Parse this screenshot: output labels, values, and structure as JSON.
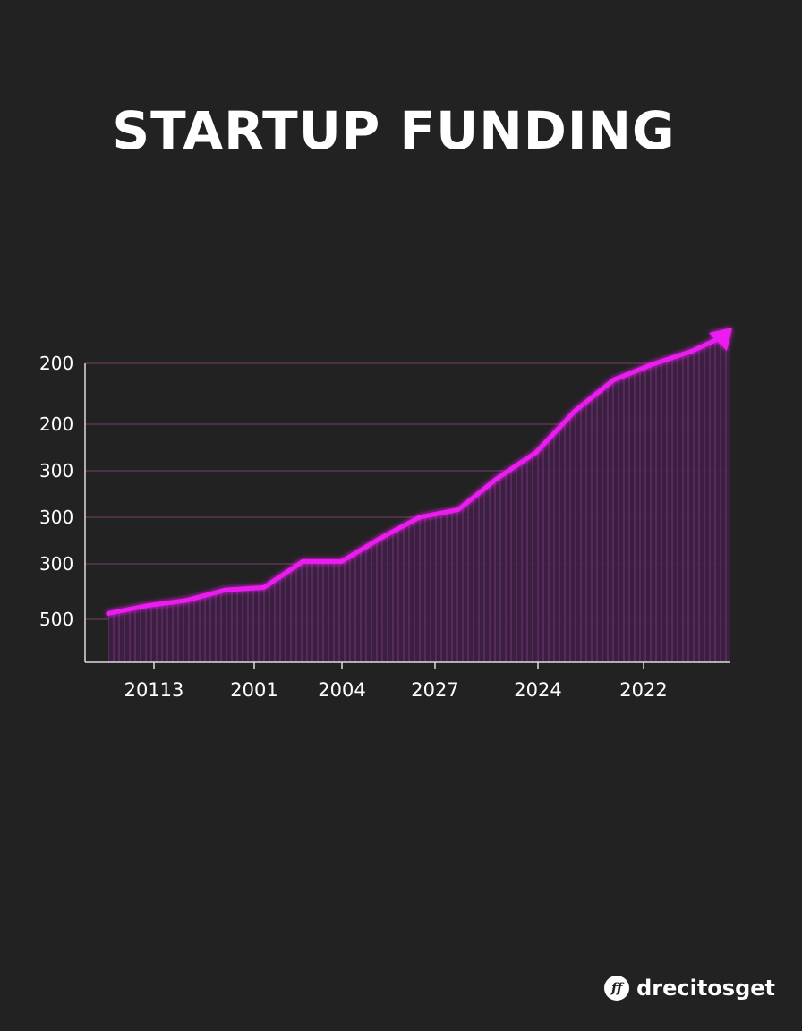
{
  "chart_data": {
    "type": "area",
    "title": "STARTUP FUNDING",
    "xlabel": "",
    "ylabel": "",
    "y_tick_labels": [
      "200",
      "200",
      "300",
      "300",
      "300",
      "500"
    ],
    "x_tick_labels": [
      "20113",
      "2001",
      "2004",
      "2027",
      "2024",
      "2022"
    ],
    "x": [
      0,
      1,
      2,
      3,
      4,
      5,
      6,
      7,
      8,
      9,
      10,
      11,
      12,
      13,
      14,
      15,
      16
    ],
    "series": [
      {
        "values": [
          0.04,
          0.07,
          0.09,
          0.13,
          0.14,
          0.24,
          0.24,
          0.33,
          0.41,
          0.44,
          0.56,
          0.66,
          0.82,
          0.94,
          1.0,
          1.05,
          1.11
        ]
      }
    ],
    "ylim": [
      0,
      1
    ],
    "grid": true,
    "colors": {
      "background": "#222222",
      "line": "#ec1ef0",
      "fill": "#4a2450",
      "grid": "#6a3a5c",
      "axis": "#dddddd"
    },
    "trend_arrow": true
  },
  "brand": {
    "logo_text": "ff",
    "name": "drecitosget"
  }
}
